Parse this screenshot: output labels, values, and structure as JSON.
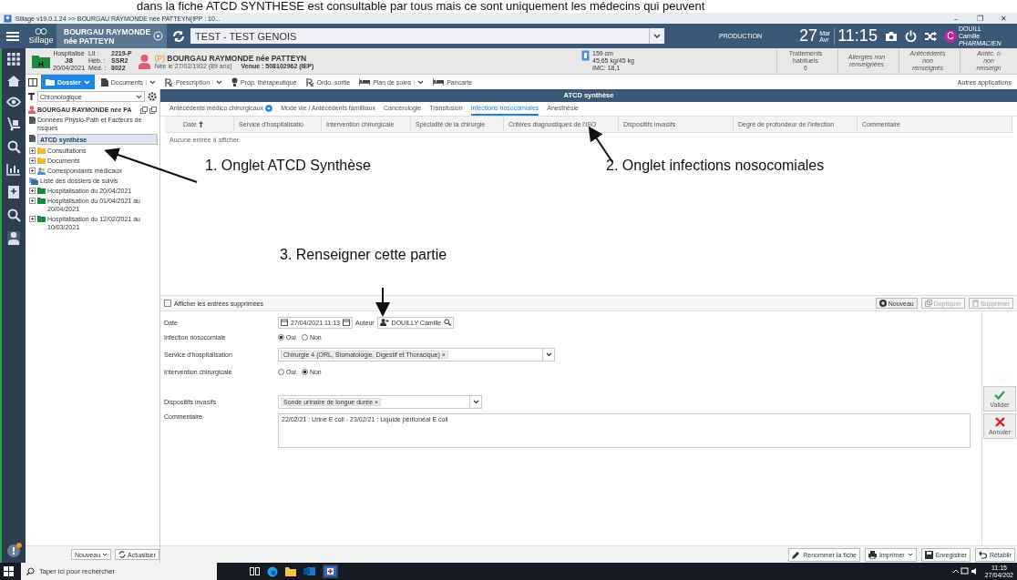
{
  "caption": "dans la fiche ATCD SYNTHESE est consultable par tous mais ce sont uniquement les médecins qui peuvent",
  "window": {
    "title": "Sillage v19.0.1.24 >> BOURGAU RAYMONDE née PATTEYN(IPP : 10...",
    "controls": [
      "–",
      "❐",
      "✕"
    ]
  },
  "header": {
    "app_name": "Sillage",
    "patient_chip": [
      "BOURGAU RAYMONDE",
      "née PATTEYN"
    ],
    "context_select": "TEST - TEST GENOIS",
    "environment": "PRODUCTION",
    "day": "27",
    "months": [
      "Mar",
      "Avr"
    ],
    "time": "11:15",
    "user": {
      "initial": "C",
      "name": [
        "DOUILL",
        "Camille"
      ],
      "role": "PHARMACIEN"
    }
  },
  "patient": {
    "stay_letter": "H",
    "status": "Hospitalisé",
    "day": "J8",
    "admission": "20/04/2021",
    "location": [
      {
        "label": "Lit :",
        "value": "2219-P"
      },
      {
        "label": "Héb. :",
        "value": "SSR2"
      },
      {
        "label": "Méd. :",
        "value": "8022"
      }
    ],
    "prefix": "(P)",
    "name": "BOURGAU RAYMONDE née PATTEYN",
    "birth": "Née le 27/02/1932 (89 ans)",
    "visit": "Venue : 508102962 (IEP)",
    "measures": [
      "159 cm",
      "45,65 kg/45 kg",
      "IMC: 18,1"
    ],
    "summary": [
      {
        "lines": [
          "Traitements",
          "habituels",
          "6"
        ],
        "kind": "plain"
      },
      {
        "lines": [
          "Allergies non",
          "renseignées"
        ],
        "kind": "missing"
      },
      {
        "lines": [
          "Antécédents",
          "non",
          "renseignés"
        ],
        "kind": "missing"
      },
      {
        "lines": [
          "Antéc. o",
          "non",
          "renseign"
        ],
        "kind": "missing"
      }
    ]
  },
  "toolbar": {
    "items": [
      {
        "label": "Dossier",
        "kind": "primary",
        "has_menu": true
      },
      {
        "label": "Documents",
        "kind": "documents",
        "has_menu": true
      },
      {
        "label": "Prescription",
        "kind": "prescription",
        "has_menu": true
      },
      {
        "label": "Prop. thérapeutique",
        "kind": "bulb",
        "has_menu": false
      },
      {
        "label": "Ordo. sortie",
        "kind": "prescription",
        "has_menu": false
      },
      {
        "label": "Plan de soins",
        "kind": "bed",
        "has_menu": true
      },
      {
        "label": "Pancarte",
        "kind": "bed",
        "has_menu": false
      }
    ],
    "right": "Autres applications"
  },
  "sidebar": {
    "sort_select": "Chronologique",
    "patient": "BOURGAU RAYMONDE née PA",
    "items": [
      {
        "label": "Données Physio-Path et Facteurs de risques",
        "kind": "doc",
        "expandable": false,
        "selected": false
      },
      {
        "label": "ATCD synthèse",
        "kind": "doc",
        "expandable": false,
        "selected": true
      },
      {
        "label": "Consultations",
        "kind": "folder",
        "expandable": true,
        "selected": false
      },
      {
        "label": "Documents",
        "kind": "folder",
        "expandable": true,
        "selected": false
      },
      {
        "label": "Correspondants médicaux",
        "kind": "people",
        "expandable": true,
        "selected": false
      },
      {
        "label": "Liste des dossiers de suivis",
        "kind": "list",
        "expandable": false,
        "selected": false
      },
      {
        "label": "Hospitalisation du 20/04/2021",
        "kind": "stay",
        "expandable": true,
        "selected": false
      },
      {
        "label": "Hospitalisation du 01/04/2021 au 20/04/2021",
        "kind": "stay",
        "expandable": true,
        "selected": false
      },
      {
        "label": "Hospitalisation du 12/02/2021 au 10/03/2021",
        "kind": "stay",
        "expandable": true,
        "selected": false
      }
    ],
    "buttons": [
      {
        "label": "Nouveau",
        "kind": "menu"
      },
      {
        "label": "Actualiser",
        "kind": "refresh"
      }
    ]
  },
  "panel": {
    "title": "ATCD synthèse",
    "tabs": [
      {
        "label": "Antécédents médico chirurgicaux",
        "info": true,
        "selected": false
      },
      {
        "label": "Mode vie / Antécédents familliaux",
        "info": false,
        "selected": false
      },
      {
        "label": "Cancérologie",
        "info": false,
        "selected": false
      },
      {
        "label": "Transfusion",
        "info": false,
        "selected": false
      },
      {
        "label": "Infections nosocomiales",
        "info": false,
        "selected": true
      },
      {
        "label": "Anesthésie",
        "info": false,
        "selected": false
      }
    ],
    "columns": [
      {
        "label": "Date",
        "sorted": true
      },
      {
        "label": "Service d'hospitalisatio",
        "sorted": false
      },
      {
        "label": "Intervention chirurgicale",
        "sorted": false
      },
      {
        "label": "Spécialité de la chirurgie",
        "sorted": false
      },
      {
        "label": "Critères diagnostiques de l'ISO",
        "sorted": false
      },
      {
        "label": "Dispositifs invasifs",
        "sorted": false
      },
      {
        "label": "Degré de profondeur de l'infection",
        "sorted": false
      },
      {
        "label": "Commentaire",
        "sorted": false
      }
    ],
    "empty": "Aucune entrée à afficher"
  },
  "annotations": [
    "1. Onglet ATCD Synthèse",
    "2. Onglet infections nosocomiales",
    "3. Renseigner cette partie"
  ],
  "form_toolbar": {
    "show_deleted": {
      "label": "Afficher les entrées supprimées",
      "checked": false
    },
    "buttons": [
      {
        "label": "Nouveau",
        "kind": "add",
        "disabled": false
      },
      {
        "label": "Dupliquer",
        "kind": "copy",
        "disabled": true
      },
      {
        "label": "Supprimer",
        "kind": "delete",
        "disabled": true
      }
    ]
  },
  "form": {
    "rows": [
      {
        "label": "Date",
        "kind": "datetime",
        "value": "27/04/2021 11:13",
        "author_label": "Auteur",
        "author": "DOUILLY Camille"
      },
      {
        "label": "Infection nosocomiale",
        "kind": "radio",
        "options": [
          {
            "label": "Oui",
            "selected": true
          },
          {
            "label": "Non",
            "selected": false
          }
        ]
      },
      {
        "label": "Service d'hospitalisation",
        "kind": "tags",
        "tags": [
          {
            "label": "Chirurgie 4 (ORL, Stomatologie, Digestif et Thoracique)",
            "remove": "×"
          }
        ]
      },
      {
        "label": "Intervention chirurgicale",
        "kind": "radio",
        "options": [
          {
            "label": "Oui",
            "selected": false
          },
          {
            "label": "Non",
            "selected": true
          }
        ]
      },
      {
        "label": "Dispositifs invasifs",
        "kind": "tags",
        "tags": [
          {
            "label": "Sonde urinaire de longue durée",
            "remove": "×"
          }
        ]
      },
      {
        "label": "Commentaire",
        "kind": "text",
        "value": "22/02/21 : Urine E coli - 23/02/21 : Liquide péritonéal E coli"
      }
    ]
  },
  "side_actions": [
    {
      "label": "Valider",
      "kind": "ok"
    },
    {
      "label": "Annuler",
      "kind": "cancel"
    }
  ],
  "footer_buttons": [
    {
      "label": "Renommer la fiche",
      "kind": "rename",
      "has_menu": false
    },
    {
      "label": "Imprimer",
      "kind": "print",
      "has_menu": true
    },
    {
      "label": "Enregistrer",
      "kind": "save",
      "has_menu": false
    },
    {
      "label": "Rétablir",
      "kind": "undo",
      "has_menu": false
    }
  ],
  "taskbar": {
    "search_placeholder": "Taper ici pour rechercher",
    "time": "11:15",
    "date": "27/04/202"
  }
}
